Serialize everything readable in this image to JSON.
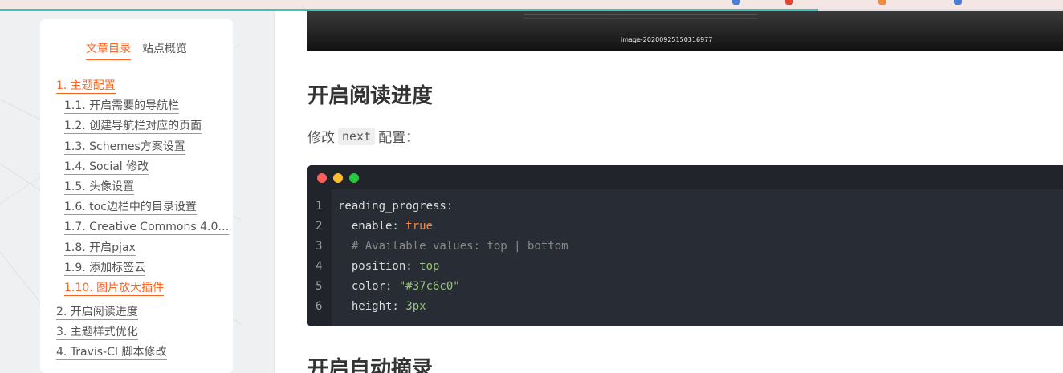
{
  "progress": {
    "percent": 77,
    "color": "#37c6c0"
  },
  "sidebar": {
    "tabs": [
      {
        "label": "文章目录",
        "active": true
      },
      {
        "label": "站点概览",
        "active": false
      }
    ],
    "toc": [
      {
        "label": "1. 主题配置",
        "level": 1,
        "active": true
      },
      {
        "label": "1.1. 开启需要的导航栏",
        "level": 2,
        "active": false
      },
      {
        "label": "1.2. 创建导航栏对应的页面",
        "level": 2,
        "active": false
      },
      {
        "label": "1.3. Schemes方案设置",
        "level": 2,
        "active": false
      },
      {
        "label": "1.4. Social 修改",
        "level": 2,
        "active": false
      },
      {
        "label": "1.5. 头像设置",
        "level": 2,
        "active": false
      },
      {
        "label": "1.6. toc边栏中的目录设置",
        "level": 2,
        "active": false
      },
      {
        "label": "1.7. Creative Commons 4.0…",
        "level": 2,
        "active": false
      },
      {
        "label": "1.8. 开启pjax",
        "level": 2,
        "active": false
      },
      {
        "label": "1.9. 添加标签云",
        "level": 2,
        "active": false
      },
      {
        "label": "1.10. 图片放大插件",
        "level": 2,
        "active": true
      },
      {
        "label": "2. 开启阅读进度",
        "level": 1,
        "active": false
      },
      {
        "label": "3. 主题样式优化",
        "level": 1,
        "active": false
      },
      {
        "label": "4. Travis-CI 脚本修改",
        "level": 1,
        "active": false
      }
    ]
  },
  "content": {
    "image_caption": "image-20200925150316977",
    "heading1": "开启阅读进度",
    "para_before": "修改",
    "para_code": "next",
    "para_after": "配置：",
    "code": {
      "lines": [
        {
          "num": "1",
          "key": "reading_progress:",
          "value": "",
          "kind": "key"
        },
        {
          "num": "2",
          "key": "  enable: ",
          "value": "true",
          "kind": "bool"
        },
        {
          "num": "3",
          "key": "  # Available values: top | bottom",
          "value": "",
          "kind": "comment"
        },
        {
          "num": "4",
          "key": "  position: ",
          "value": "top",
          "kind": "str"
        },
        {
          "num": "5",
          "key": "  color: ",
          "value": "\"#37c6c0\"",
          "kind": "str"
        },
        {
          "num": "6",
          "key": "  height: ",
          "value": "3px",
          "kind": "str"
        }
      ],
      "dot_colors": [
        "#ff5f56",
        "#ffbd2e",
        "#27c93f"
      ]
    },
    "heading2": "开启自动摘录"
  }
}
